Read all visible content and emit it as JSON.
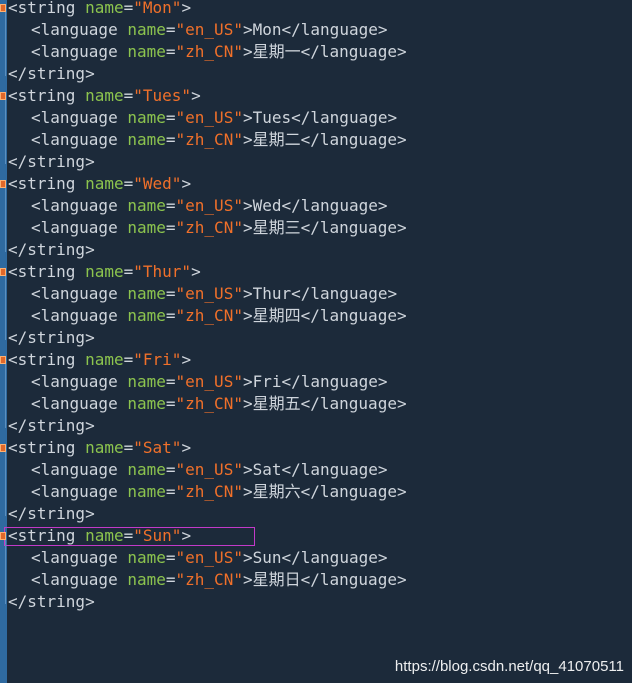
{
  "code": {
    "blocks": [
      {
        "name": "Mon",
        "en": "Mon",
        "zh": "星期一"
      },
      {
        "name": "Tues",
        "en": "Tues",
        "zh": "星期二"
      },
      {
        "name": "Wed",
        "en": "Wed",
        "zh": "星期三"
      },
      {
        "name": "Thur",
        "en": "Thur",
        "zh": "星期四"
      },
      {
        "name": "Fri",
        "en": "Fri",
        "zh": "星期五"
      },
      {
        "name": "Sat",
        "en": "Sat",
        "zh": "星期六"
      },
      {
        "name": "Sun",
        "en": "Sun",
        "zh": "星期日"
      }
    ],
    "tokens": {
      "string_open": "<string",
      "string_close": "</string>",
      "language_open": "<language",
      "language_close": "</language>",
      "name_attr": "name",
      "equals": "=",
      "quote": "\"",
      "gt": ">",
      "locale_en": "en_US",
      "locale_zh": "zh_CN"
    },
    "highlighted_block": "Sun"
  },
  "watermark": "https://blog.csdn.net/qq_41070511",
  "colors": {
    "background": "#1c2a3a",
    "gutter": "#2f6aa0",
    "tag": "#cfd5dc",
    "attribute": "#8cc44e",
    "value": "#f0702a",
    "fold_marker": "#e0682a",
    "highlight_border": "#c23ac8"
  }
}
